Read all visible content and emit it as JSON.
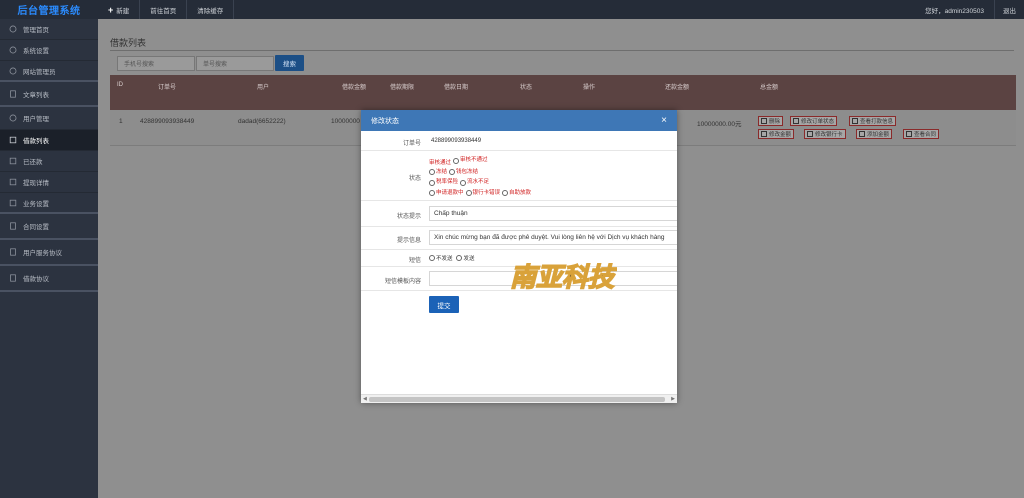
{
  "topbar": {
    "brand": "后台管理系统",
    "new_label": "新建",
    "home_label": "前往首页",
    "cache_label": "清除缓存",
    "user_label": "您好，admin230503",
    "logout_label": "退出"
  },
  "sidebar": {
    "items": [
      {
        "label": "管理首页",
        "icon": "home-icon"
      },
      {
        "label": "系统设置",
        "icon": "gear-icon"
      },
      {
        "label": "网站管理员",
        "icon": "user-icon"
      },
      {
        "label": "文章列表",
        "icon": "document-icon"
      },
      {
        "label": "用户管理",
        "icon": "users-icon"
      },
      {
        "label": "借款列表",
        "icon": "list-icon"
      },
      {
        "label": "已还款",
        "icon": "check-icon"
      },
      {
        "label": "提现详情",
        "icon": "wallet-icon"
      },
      {
        "label": "业务设置",
        "icon": "briefcase-icon"
      },
      {
        "label": "合同设置",
        "icon": "contract-icon"
      },
      {
        "label": "用户服务协议",
        "icon": "agreement-icon"
      },
      {
        "label": "借款协议",
        "icon": "agreement-icon"
      }
    ]
  },
  "main": {
    "title": "借款列表",
    "search_phone_placeholder": "手机号搜索",
    "search_order_placeholder": "单号搜索",
    "search_button": "搜索",
    "columns": [
      "ID",
      "订单号",
      "用户",
      "借款金额",
      "借款期限",
      "借款日期",
      "状态",
      "操作",
      "还款金额",
      "总金额"
    ],
    "row": {
      "id": "1",
      "order_no": "428899093938449",
      "user": "dadad(6652222)",
      "amount": "10000000",
      "total": "10000000.00元"
    },
    "actions": [
      "删除",
      "修改订单状态",
      "查看打款信息",
      "修改金额",
      "修改银行卡",
      "添加金额",
      "查看合同"
    ]
  },
  "modal": {
    "title": "修改状态",
    "order_label": "订单号",
    "order_value": "428899093938449",
    "status_label": "状态",
    "status_options": [
      "审核通过",
      "审核不通过",
      "冻结",
      "钱包冻结",
      "税率保险",
      "流水不足",
      "申请退款中",
      "银行卡错误",
      "自助放款"
    ],
    "hint_label": "状态提示",
    "hint_value": "Chấp thuận",
    "prompt_label": "提示信息",
    "prompt_value": "Xin chúc mừng bạn đã được phê duyệt. Vui lòng liên hệ với Dịch vụ khách hàng",
    "sms_label": "短信",
    "sms_options": [
      "不发送",
      "发送"
    ],
    "sms_template_label": "短信模板内容",
    "submit_label": "提交"
  },
  "watermark": {
    "text": "南亚科技"
  },
  "colors": {
    "topbar": "#252c38",
    "sidebar": "#2c3340",
    "modal_header": "#3e77b6",
    "submit": "#1b62b7",
    "table_header": "#5b4342",
    "status_red": "#d01f1f"
  }
}
